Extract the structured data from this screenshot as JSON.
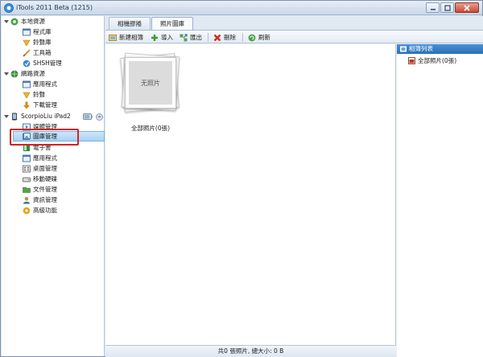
{
  "window": {
    "title": "iTools 2011 Beta (1215)"
  },
  "sidebar": {
    "local_group": "本地資源",
    "local_items": [
      {
        "label": "程式庫",
        "icon": "program-library-icon"
      },
      {
        "label": "鈴聲庫",
        "icon": "ringtone-library-icon"
      },
      {
        "label": "工具箱",
        "icon": "toolbox-icon"
      },
      {
        "label": "SHSH管理",
        "icon": "shsh-icon"
      }
    ],
    "network_group": "網路資源",
    "network_items": [
      {
        "label": "應用程式",
        "icon": "apps-icon"
      },
      {
        "label": "鈴聲",
        "icon": "ringtone-icon"
      },
      {
        "label": "下載管理",
        "icon": "download-icon"
      }
    ],
    "device_group": "ScorpioLiu iPad2",
    "device_items": [
      {
        "label": "媒體管理",
        "icon": "media-icon"
      },
      {
        "label": "圖庫管理",
        "icon": "gallery-icon"
      },
      {
        "label": "電子書",
        "icon": "ebook-icon"
      },
      {
        "label": "應用程式",
        "icon": "apps-icon"
      },
      {
        "label": "桌面管理",
        "icon": "desktop-icon"
      },
      {
        "label": "移動硬碟",
        "icon": "disk-icon"
      },
      {
        "label": "文件管理",
        "icon": "folder-icon"
      },
      {
        "label": "資訊管理",
        "icon": "contacts-icon"
      },
      {
        "label": "高級功能",
        "icon": "advanced-icon"
      }
    ],
    "selected_index": 1
  },
  "tabs": [
    {
      "label": "相機膠捲",
      "active": false
    },
    {
      "label": "照片圖庫",
      "active": true
    }
  ],
  "toolbar": {
    "new_album": "新建相簿",
    "import": "導入",
    "export": "匯出",
    "delete": "刪除",
    "refresh": "刷新"
  },
  "album": {
    "placeholder": "无照片",
    "caption": "全部照片(0張)"
  },
  "right_panel": {
    "header": "相簿列表",
    "item": "全部照片(0張)"
  },
  "status": {
    "text": "共0 張照片, 總大小: 0 B"
  },
  "colors": {
    "selection": "#a9d1f5",
    "highlight_box": "#d02424",
    "panel_header": "#2b6fb5"
  }
}
